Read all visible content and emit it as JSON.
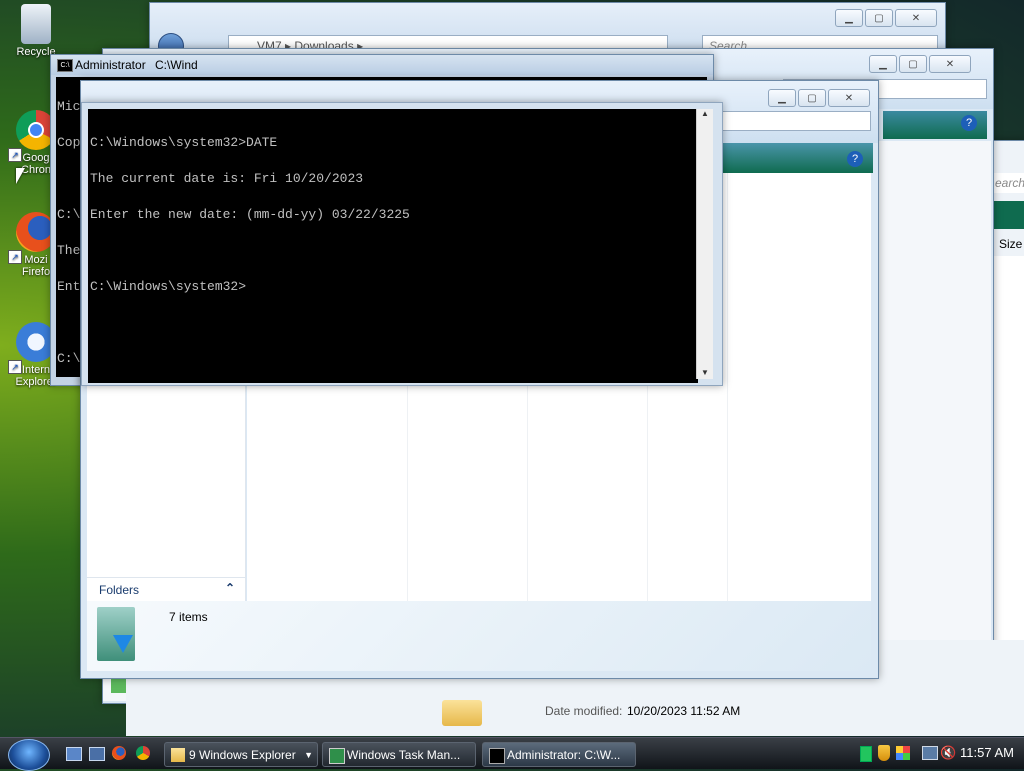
{
  "desktop": {
    "icons": [
      {
        "label": "Recycle"
      },
      {
        "label": "Goog\nChron"
      },
      {
        "label": "Mozi\nFirefo"
      },
      {
        "label": "Intern\nExplorer"
      }
    ]
  },
  "explorer_back": {
    "path": "VM7 ▸ Downloads ▸",
    "search_placeholder": "Search",
    "column_size": "Size",
    "search_small": "earch"
  },
  "explorer_front": {
    "folders_label": "Folders",
    "items_count": "7 items"
  },
  "bottom_details": {
    "date_label": "Date modified:",
    "date_value": "10/20/2023 11:52 AM"
  },
  "cmd_back": {
    "title": "Administrator",
    "title2": "C:\\Wind",
    "lines": [
      "Mic",
      "Cop",
      "",
      "C:\\",
      "The",
      "Ent",
      "",
      "C:\\"
    ]
  },
  "cmd_front": {
    "lines": [
      "C:\\Windows\\system32>DATE",
      "The current date is: Fri 10/20/2023",
      "Enter the new date: (mm-dd-yy) 03/22/3225",
      "",
      "C:\\Windows\\system32>"
    ]
  },
  "taskbar": {
    "buttons": [
      {
        "label": "9 Windows Explorer"
      },
      {
        "label": "Windows Task Man..."
      },
      {
        "label": "Administrator: C:\\W..."
      }
    ],
    "clock": "11:57 AM"
  },
  "colors": {
    "accent_green": "#0f6b4f",
    "progress_green": "#5cb85c"
  }
}
